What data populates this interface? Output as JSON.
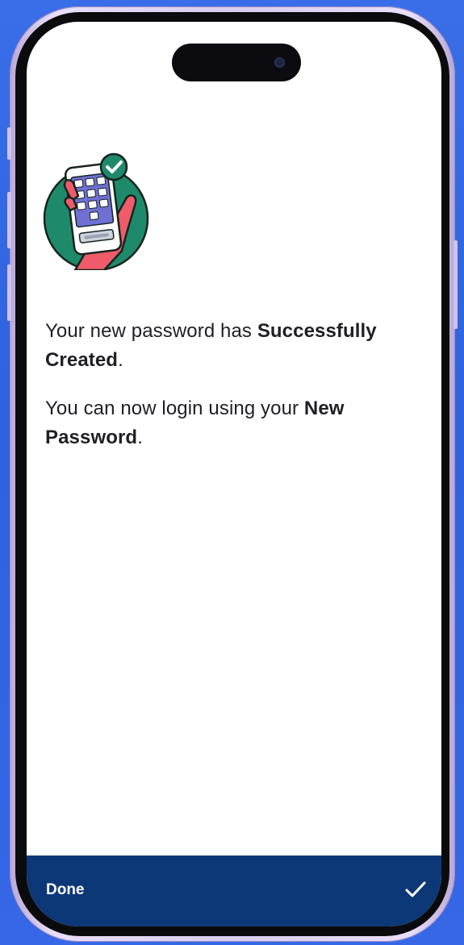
{
  "message": {
    "line1_prefix": "Your new password has ",
    "line1_bold": "Successfully Created",
    "line1_suffix": ".",
    "line2_prefix": "You can now login using your ",
    "line2_bold": "New Password",
    "line2_suffix": "."
  },
  "bottom_bar": {
    "done_label": "Done",
    "confirm_icon": "checkmark-icon"
  },
  "illustration": {
    "icon": "phone-password-success-icon"
  },
  "colors": {
    "background": "#3a6ee8",
    "bottom_bar": "#0d3877",
    "illustration_circle": "#1f8a6b",
    "hand": "#ef5b6a",
    "text": "#1f1f24"
  }
}
